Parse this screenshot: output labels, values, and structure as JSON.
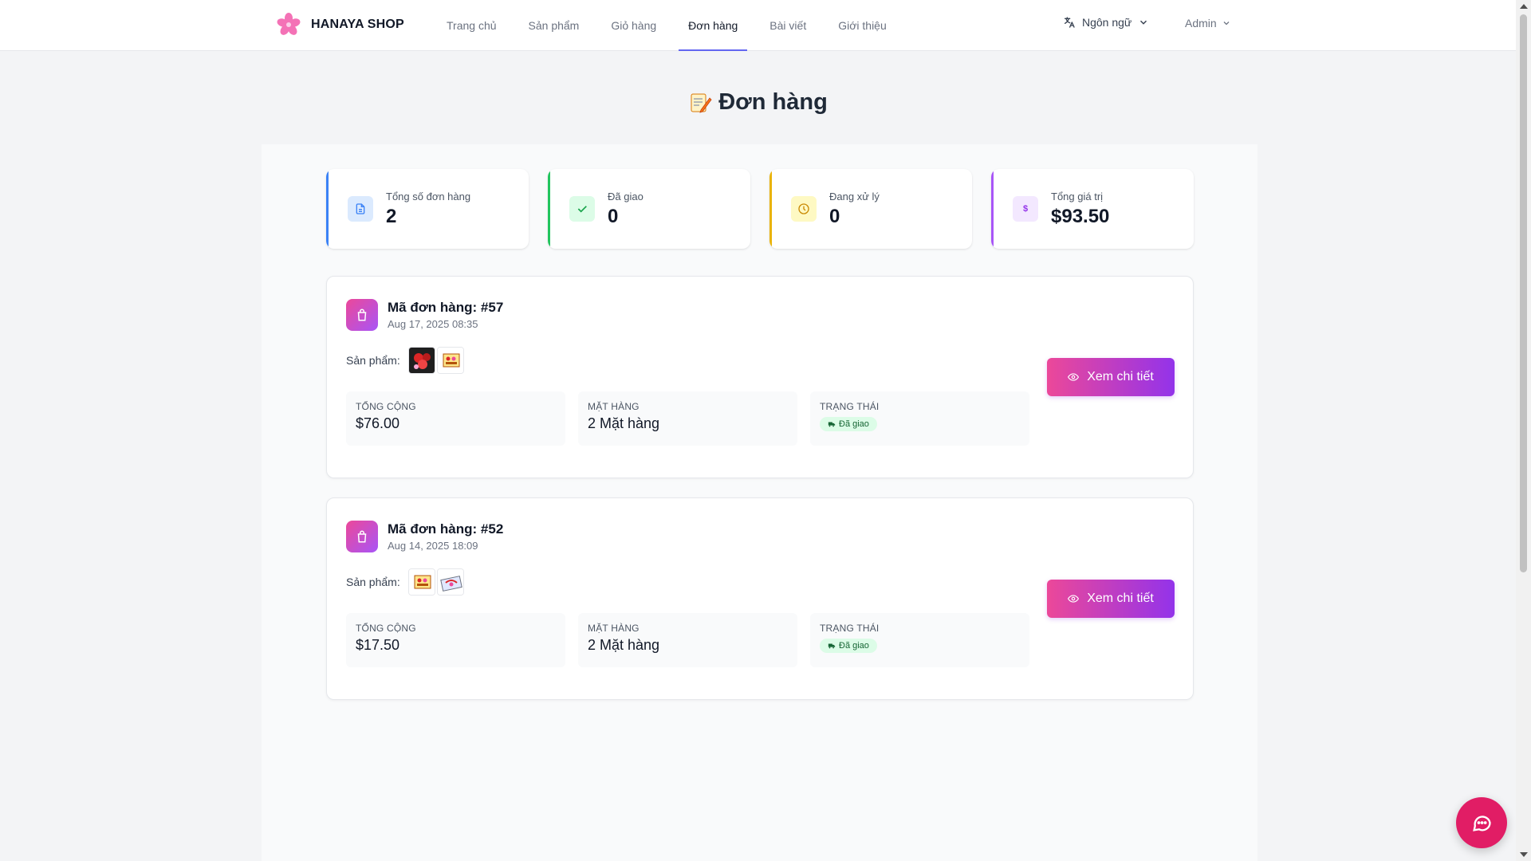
{
  "header": {
    "brand": "HANAYA SHOP",
    "nav": [
      "Trang chủ",
      "Sản phẩm",
      "Giỏ hàng",
      "Đơn hàng",
      "Bài viết",
      "Giới thiệu"
    ],
    "active_nav": "Đơn hàng",
    "language_label": "Ngôn ngữ",
    "user_label": "Admin"
  },
  "page": {
    "title": "Đơn hàng"
  },
  "stats": [
    {
      "label": "Tổng số đơn hàng",
      "value": "2",
      "icon": "document-icon",
      "color": "#3b82f6"
    },
    {
      "label": "Đã giao",
      "value": "0",
      "icon": "check-icon",
      "color": "#22c55e"
    },
    {
      "label": "Đang xử lý",
      "value": "0",
      "icon": "clock-icon",
      "color": "#eab308"
    },
    {
      "label": "Tổng giá trị",
      "value": "$93.50",
      "icon": "dollar-icon",
      "color": "#a855f7"
    }
  ],
  "orders": [
    {
      "id_label": "Mã đơn hàng: #57",
      "date": "Aug 17, 2025 08:35",
      "products_label": "Sản phẩm:",
      "total_label": "TỔNG CỘNG",
      "total": "$76.00",
      "items_label": "MẶT HÀNG",
      "items": "2 Mặt hàng",
      "status_label": "TRẠNG THÁI",
      "status": "Đã giao",
      "button": "Xem chi tiết"
    },
    {
      "id_label": "Mã đơn hàng: #52",
      "date": "Aug 14, 2025 18:09",
      "products_label": "Sản phẩm:",
      "total_label": "TỔNG CỘNG",
      "total": "$17.50",
      "items_label": "MẶT HÀNG",
      "items": "2 Mặt hàng",
      "status_label": "TRẠNG THÁI",
      "status": "Đã giao",
      "button": "Xem chi tiết"
    }
  ],
  "colors": {
    "accent": "#6366f1",
    "button_gradient_start": "#ec4899",
    "button_gradient_end": "#9333ea",
    "chat": "#e11d65",
    "status_bg": "#dcfce7"
  }
}
